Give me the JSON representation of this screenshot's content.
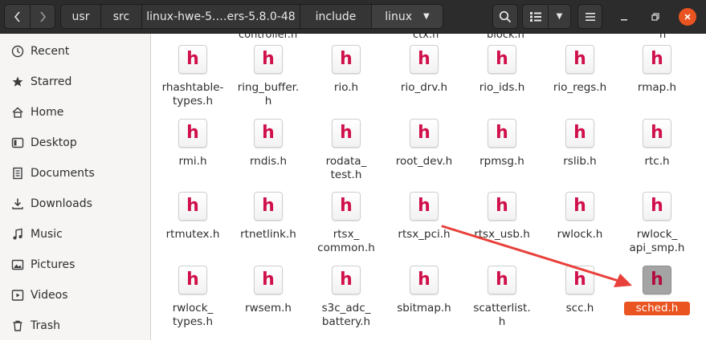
{
  "header": {
    "breadcrumbs": [
      "usr",
      "src",
      "linux-hwe-5.…ers-5.8.0-48",
      "include",
      "linux"
    ]
  },
  "sidebar": {
    "items": [
      {
        "label": "Recent",
        "icon": "clock-icon"
      },
      {
        "label": "Starred",
        "icon": "star-icon"
      },
      {
        "label": "Home",
        "icon": "home-icon"
      },
      {
        "label": "Desktop",
        "icon": "desktop-icon"
      },
      {
        "label": "Documents",
        "icon": "document-icon"
      },
      {
        "label": "Downloads",
        "icon": "download-icon"
      },
      {
        "label": "Music",
        "icon": "music-icon"
      },
      {
        "label": "Pictures",
        "icon": "picture-icon"
      },
      {
        "label": "Videos",
        "icon": "video-icon"
      },
      {
        "label": "Trash",
        "icon": "trash-icon"
      }
    ]
  },
  "files": {
    "icon_glyph": "h",
    "partial_row": [
      "controller.h",
      "ctx.h",
      "block.h",
      "h"
    ],
    "rows": [
      [
        "rhashtable-\ntypes.h",
        "ring_buffer.\nh",
        "rio.h",
        "rio_drv.h",
        "rio_ids.h",
        "rio_regs.h",
        "rmap.h"
      ],
      [
        "rmi.h",
        "rndis.h",
        "rodata_\ntest.h",
        "root_dev.h",
        "rpmsg.h",
        "rslib.h",
        "rtc.h"
      ],
      [
        "rtmutex.h",
        "rtnetlink.h",
        "rtsx_\ncommon.h",
        "rtsx_pci.h",
        "rtsx_usb.h",
        "rwlock.h",
        "rwlock_\napi_smp.h"
      ],
      [
        "rwlock_\ntypes.h",
        "rwsem.h",
        "s3c_adc_\nbattery.h",
        "sbitmap.h",
        "scatterlist.\nh",
        "scc.h",
        "sched.h"
      ]
    ],
    "selected": "sched.h"
  },
  "colors": {
    "accent": "#e95420",
    "header_bg": "#2c2c2c",
    "annotation_arrow": "#e8403a",
    "icon_letter": "#d0104a"
  }
}
